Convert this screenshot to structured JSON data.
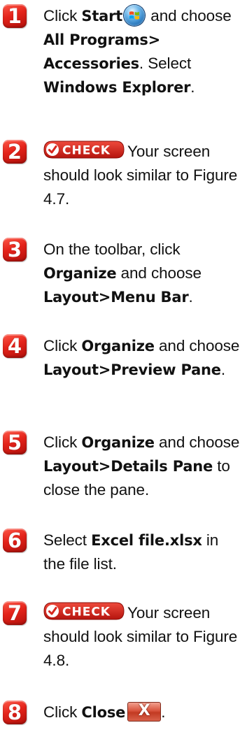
{
  "steps": [
    {
      "number": "1",
      "segments": [
        {
          "text": "Click ",
          "bold": false
        },
        {
          "text": "Start",
          "bold": true
        },
        {
          "icon": "windows-start-orb-icon"
        },
        {
          "text": " and choose ",
          "bold": false
        },
        {
          "text": "All Programs> Accessories",
          "bold": true
        },
        {
          "text": ". Select ",
          "bold": false
        },
        {
          "text": "Windows Explorer",
          "bold": true
        },
        {
          "text": ".",
          "bold": false
        }
      ]
    },
    {
      "number": "2",
      "segments": [
        {
          "icon": "check-badge-icon",
          "label": "CHECK"
        },
        {
          "text": "Your screen should look similar to Figure 4.7.",
          "bold": false
        }
      ]
    },
    {
      "number": "3",
      "segments": [
        {
          "text": "On the toolbar, click ",
          "bold": false
        },
        {
          "text": "Organize",
          "bold": true
        },
        {
          "text": " and choose ",
          "bold": false
        },
        {
          "text": "Layout>Menu Bar",
          "bold": true
        },
        {
          "text": ".",
          "bold": false
        }
      ]
    },
    {
      "number": "4",
      "segments": [
        {
          "text": "Click ",
          "bold": false
        },
        {
          "text": "Organize",
          "bold": true
        },
        {
          "text": " and choose ",
          "bold": false
        },
        {
          "text": "Layout>Preview Pane",
          "bold": true
        },
        {
          "text": ".",
          "bold": false
        }
      ]
    },
    {
      "number": "5",
      "segments": [
        {
          "text": "Click ",
          "bold": false
        },
        {
          "text": "Organize",
          "bold": true
        },
        {
          "text": " and choose ",
          "bold": false
        },
        {
          "text": "Layout>Details Pane",
          "bold": true
        },
        {
          "text": " to close the pane.",
          "bold": false
        }
      ]
    },
    {
      "number": "6",
      "segments": [
        {
          "text": "Select ",
          "bold": false
        },
        {
          "text": "Excel file.xlsx",
          "bold": true
        },
        {
          "text": " in the file list.",
          "bold": false
        }
      ]
    },
    {
      "number": "7",
      "segments": [
        {
          "icon": "check-badge-icon",
          "label": "CHECK"
        },
        {
          "text": "Your screen should look similar to Figure 4.8.",
          "bold": false
        }
      ]
    },
    {
      "number": "8",
      "segments": [
        {
          "text": "Click ",
          "bold": false
        },
        {
          "text": "Close",
          "bold": true
        },
        {
          "icon": "close-button-icon",
          "label": "X"
        },
        {
          "text": ".",
          "bold": false
        }
      ]
    }
  ],
  "colors": {
    "badge_red": "#e4231a",
    "check_red": "#d7261d",
    "text": "#111111"
  }
}
